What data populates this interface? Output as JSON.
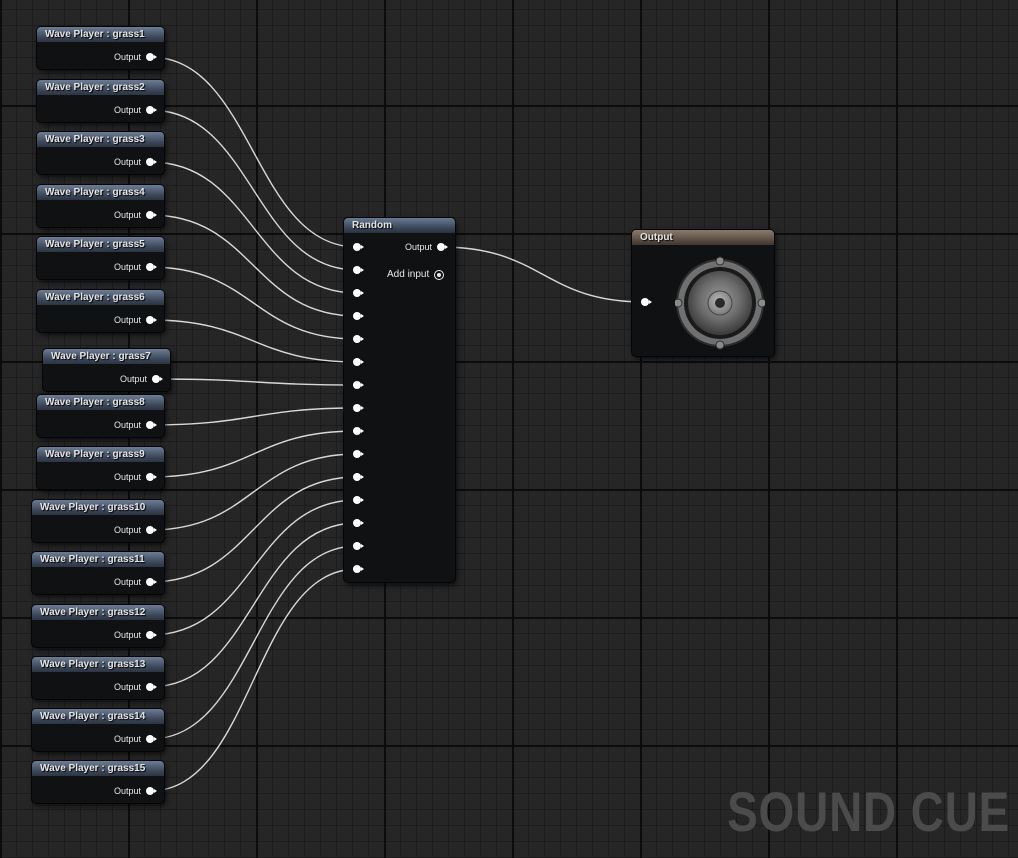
{
  "editor": {
    "watermark": "SOUND CUE"
  },
  "wave_players": [
    {
      "title": "Wave Player : grass1",
      "output_label": "Output"
    },
    {
      "title": "Wave Player : grass2",
      "output_label": "Output"
    },
    {
      "title": "Wave Player : grass3",
      "output_label": "Output"
    },
    {
      "title": "Wave Player : grass4",
      "output_label": "Output"
    },
    {
      "title": "Wave Player : grass5",
      "output_label": "Output"
    },
    {
      "title": "Wave Player : grass6",
      "output_label": "Output"
    },
    {
      "title": "Wave Player : grass7",
      "output_label": "Output"
    },
    {
      "title": "Wave Player : grass8",
      "output_label": "Output"
    },
    {
      "title": "Wave Player : grass9",
      "output_label": "Output"
    },
    {
      "title": "Wave Player : grass10",
      "output_label": "Output"
    },
    {
      "title": "Wave Player : grass11",
      "output_label": "Output"
    },
    {
      "title": "Wave Player : grass12",
      "output_label": "Output"
    },
    {
      "title": "Wave Player : grass13",
      "output_label": "Output"
    },
    {
      "title": "Wave Player : grass14",
      "output_label": "Output"
    },
    {
      "title": "Wave Player : grass15",
      "output_label": "Output"
    }
  ],
  "random_node": {
    "title": "Random",
    "output_label": "Output",
    "add_input_label": "Add input",
    "input_count": 15
  },
  "output_node": {
    "title": "Output",
    "icon": "speaker-icon"
  },
  "colors": {
    "wave_header": "#3a4558",
    "random_header": "#384456",
    "output_header": "#564a40",
    "wire": "#d8d8d8",
    "background": "#262626"
  }
}
